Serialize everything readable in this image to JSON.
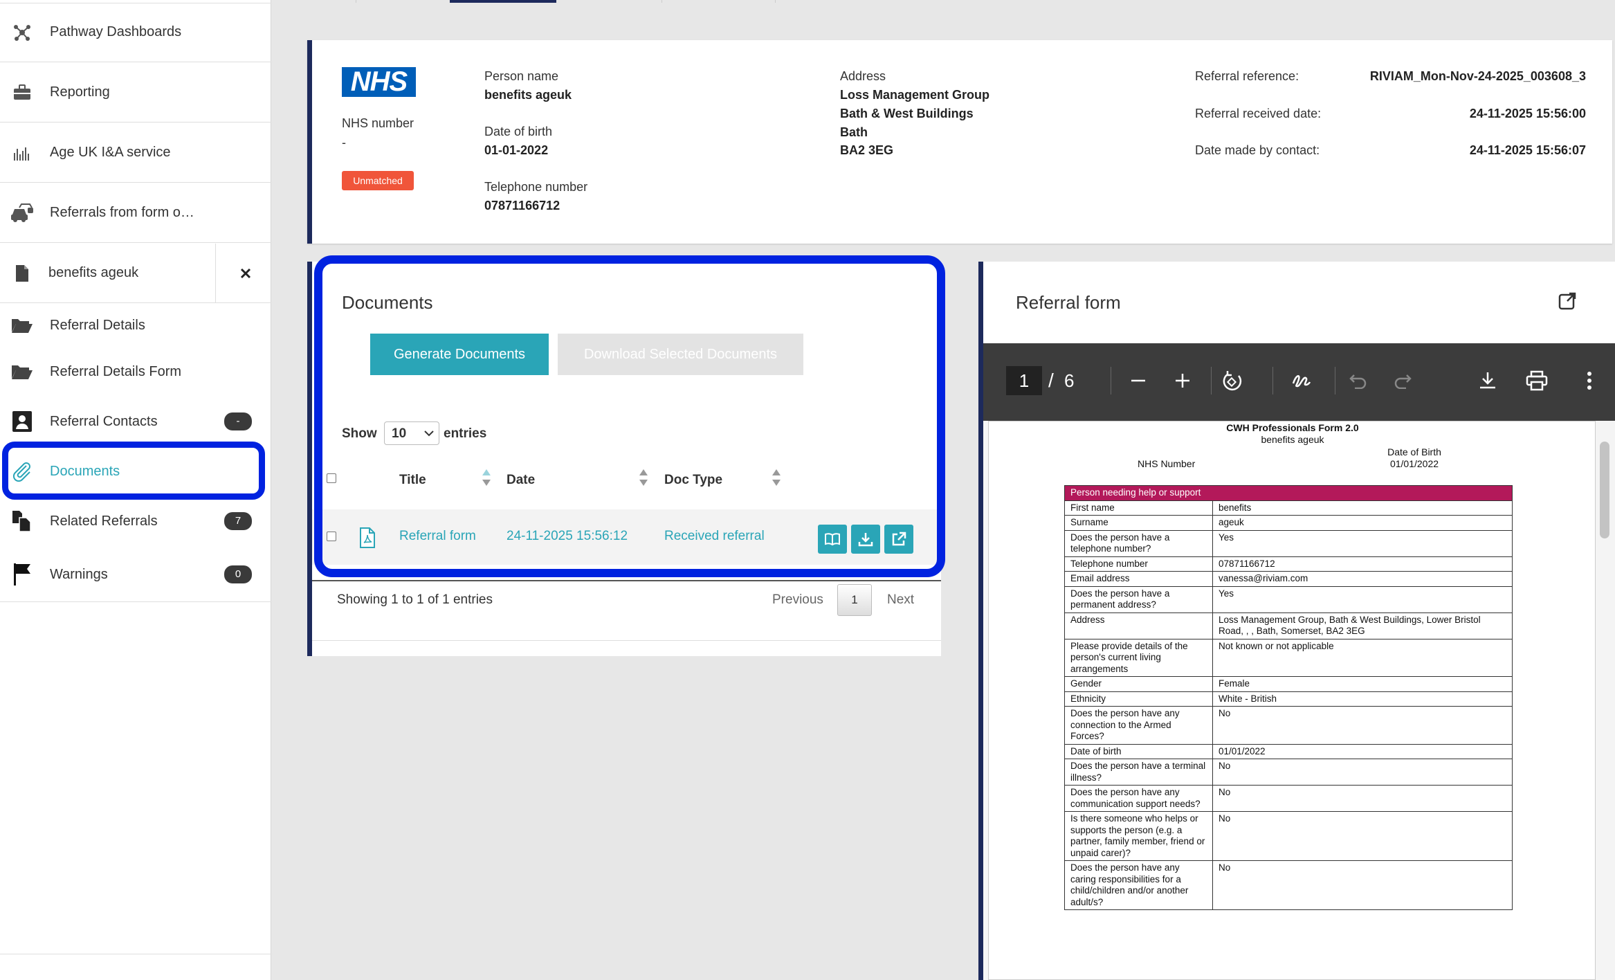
{
  "sidebar": {
    "nav": [
      {
        "label": "Pathway Dashboards",
        "icon": "network-icon"
      },
      {
        "label": "Reporting",
        "icon": "briefcase-icon"
      },
      {
        "label": "Age UK I&A service",
        "icon": "bar-chart-icon"
      },
      {
        "label": "Referrals from form o…",
        "icon": "cars-icon"
      }
    ],
    "open_record": {
      "label": "benefits ageuk",
      "icon": "file-icon",
      "close": "✕"
    },
    "sub": [
      {
        "label": "Referral Details",
        "icon": "folder-open-icon",
        "badge": ""
      },
      {
        "label": "Referral Details Form",
        "icon": "folder-open-icon",
        "badge": ""
      },
      {
        "label": "Referral Contacts",
        "icon": "contact-card-icon",
        "badge": "-"
      },
      {
        "label": "Documents",
        "icon": "paperclip-icon",
        "badge": ""
      },
      {
        "label": "Related Referrals",
        "icon": "copy-files-icon",
        "badge": "7"
      },
      {
        "label": "Warnings",
        "icon": "flag-icon",
        "badge": "0"
      }
    ],
    "active_color": "#2aa5b7"
  },
  "header": {
    "logo": "NHS",
    "nhs_number_label": "NHS number",
    "nhs_number": "-",
    "status_badge": "Unmatched",
    "person_name_label": "Person name",
    "person_name": "benefits ageuk",
    "dob_label": "Date of birth",
    "dob": "01-01-2022",
    "phone_label": "Telephone number",
    "phone": "07871166712",
    "address_label": "Address",
    "address_lines": [
      "Loss Management Group",
      "Bath & West Buildings",
      "Bath",
      "BA2 3EG"
    ],
    "ref_label": "Referral reference:",
    "ref_value": "RIVIAM_Mon-Nov-24-2025_003608_3",
    "received_label": "Referral received date:",
    "received_value": "24-11-2025 15:56:00",
    "contact_label": "Date made by contact:",
    "contact_value": "24-11-2025 15:56:07",
    "accent": "#1d2a5c",
    "status_color": "#f0553a"
  },
  "documents": {
    "title": "Documents",
    "generate_button": "Generate Documents",
    "download_button": "Download Selected Documents",
    "show_label": "Show",
    "entries_value": "10",
    "entries_label": "entries",
    "columns": [
      "Title",
      "Date",
      "Doc Type"
    ],
    "rows": [
      {
        "title": "Referral form",
        "date": "24-11-2025 15:56:12",
        "doc_type": "Received referral"
      }
    ],
    "footer_text": "Showing 1 to 1 of 1 entries",
    "prev": "Previous",
    "page": "1",
    "next": "Next",
    "highlight_color": "#0022e0"
  },
  "referral_form": {
    "title": "Referral form",
    "pdf": {
      "page_current": "1",
      "page_sep": "/",
      "page_total": "6",
      "doc_title": "CWH Professionals Form 2.0",
      "doc_subtitle": "benefits ageuk",
      "nhs_number_label": "NHS Number",
      "dob_label": "Date of Birth",
      "dob_value": "01/01/2022",
      "section_header": "Person needing help or support",
      "rows": [
        {
          "q": "First name",
          "a": "benefits"
        },
        {
          "q": "Surname",
          "a": "ageuk"
        },
        {
          "q": "Does the person have a telephone number?",
          "a": "Yes"
        },
        {
          "q": "Telephone number",
          "a": "07871166712"
        },
        {
          "q": "Email address",
          "a": "vanessa@riviam.com"
        },
        {
          "q": "Does the person have a permanent address?",
          "a": "Yes"
        },
        {
          "q": "Address",
          "a": "Loss Management Group, Bath & West Buildings, Lower Bristol Road, , , Bath, Somerset, BA2 3EG"
        },
        {
          "q": "Please provide details of the person's current living arrangements",
          "a": "Not known or not applicable"
        },
        {
          "q": "Gender",
          "a": "Female"
        },
        {
          "q": "Ethnicity",
          "a": "White - British"
        },
        {
          "q": "Does the person have any connection to the Armed Forces?",
          "a": "No"
        },
        {
          "q": "Date of birth",
          "a": "01/01/2022"
        },
        {
          "q": "Does the person have a terminal illness?",
          "a": "No"
        },
        {
          "q": "Does the person have any communication support needs?",
          "a": "No"
        },
        {
          "q": "Is there someone who helps or supports the person (e.g. a partner, family member, friend or unpaid carer)?",
          "a": "No"
        },
        {
          "q": "Does the person have any caring responsibilities for a child/children and/or another adult/s?",
          "a": "No"
        }
      ],
      "section_color": "#b3195a"
    }
  }
}
